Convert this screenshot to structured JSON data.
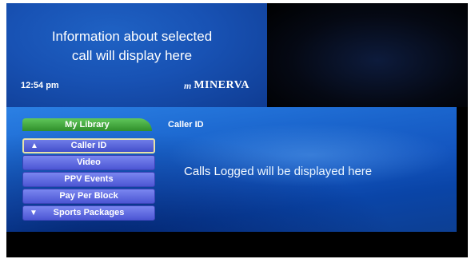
{
  "info": {
    "message_line1": "Information about selected",
    "message_line2": "call will display here",
    "time": "12:54 pm",
    "logo_mark": "m",
    "logo_text": "MINERVA"
  },
  "menu": {
    "tab_label": "My Library",
    "section_title": "Caller ID",
    "items": [
      {
        "label": "Caller ID",
        "selected": true,
        "icon": "up-arrow-icon"
      },
      {
        "label": "Video"
      },
      {
        "label": "PPV Events"
      },
      {
        "label": "Pay Per Block"
      },
      {
        "label": "Sports Packages",
        "icon": "down-arrow-icon"
      }
    ],
    "calls_message": "Calls Logged will be displayed here"
  },
  "colors": {
    "tab_green": "#3fa83a",
    "menu_item_purple": "#5a64dc",
    "panel_blue": "#1a64cc"
  }
}
